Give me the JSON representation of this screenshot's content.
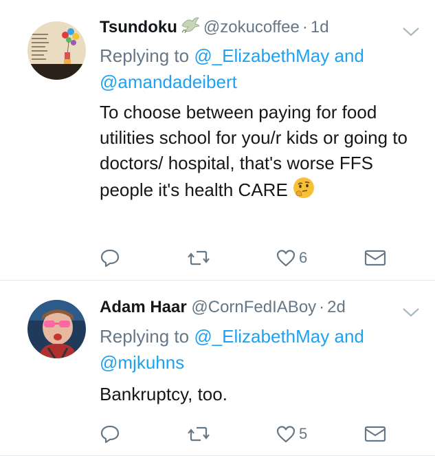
{
  "tweets": [
    {
      "name": "Tsundoku",
      "handle": "@zokucoffee",
      "dot": "·",
      "time": "1d",
      "replying_prefix": "Replying to",
      "reply_user1": "@_ElizabethMay",
      "reply_and": "and",
      "reply_user2": "@amandadeibert",
      "text": "To choose between paying for food utilities school for you/r kids or going to doctors/ hospital, that's worse FFS people it's health CARE",
      "likes": "6"
    },
    {
      "name": "Adam Haar",
      "handle": "@CornFedIABoy",
      "dot": "·",
      "time": "2d",
      "replying_prefix": "Replying to",
      "reply_user1": "@_ElizabethMay",
      "reply_and": "and",
      "reply_user2": "@mjkuhns",
      "text": "Bankruptcy, too.",
      "likes": "5"
    }
  ],
  "colors": {
    "link": "#1da1f2",
    "muted": "#657786",
    "text": "#14171a",
    "divider": "#e1e8ed"
  },
  "icons": [
    "dove-icon",
    "chevron-down-icon",
    "reply-icon",
    "retweet-icon",
    "heart-icon",
    "mail-icon",
    "thinking-face-emoji"
  ]
}
